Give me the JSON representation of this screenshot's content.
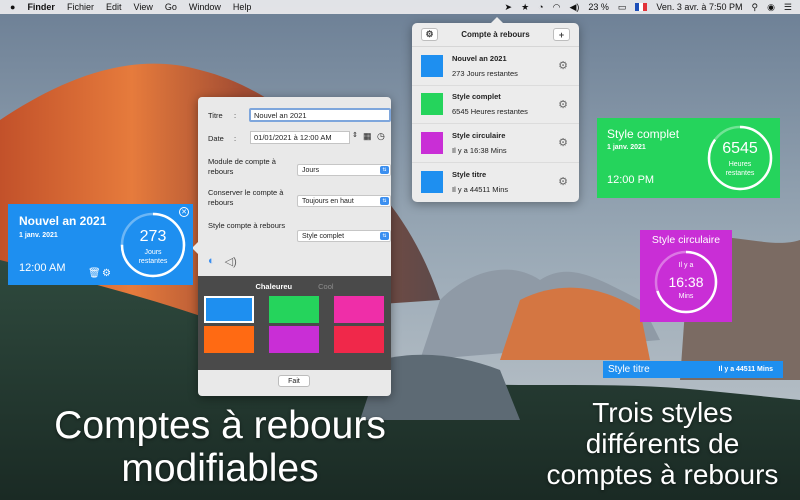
{
  "menubar": {
    "app": "Finder",
    "menus": [
      "Fichier",
      "Edit",
      "View",
      "Go",
      "Window",
      "Help"
    ],
    "battery": "23 %",
    "datetime": "Ven. 3 avr. à  7:50 PM"
  },
  "popover": {
    "title": "Compte à rebours",
    "items": [
      {
        "title": "Nouvel an 2021",
        "subtitle": "273 Jours restantes",
        "color": "#1e8ff0"
      },
      {
        "title": "Style complet",
        "subtitle": "6545 Heures restantes",
        "color": "#25d45c"
      },
      {
        "title": "Style circulaire",
        "subtitle": "Il y a 16:38 Mins",
        "color": "#c92ed6"
      },
      {
        "title": "Style titre",
        "subtitle": "Il y a 44511 Mins",
        "color": "#1e8ff0"
      }
    ]
  },
  "editor": {
    "title_label": "Titre",
    "title_value": "Nouvel an 2021",
    "date_label": "Date",
    "date_value": "01/01/2021 à 12:00 AM",
    "module_label": "Module de compte à rebours",
    "module_value": "Jours",
    "keep_label": "Conserver le compte à rebours",
    "keep_value": "Toujours en haut",
    "style_label": "Style compte à rebours",
    "style_value": "Style complet",
    "tab_warm": "Chaleureu",
    "tab_cool": "Cool",
    "swatches": [
      "#1e8ff0",
      "#25d45c",
      "#ef2ea8",
      "#ff6a13",
      "#c92ed6",
      "#f0284a"
    ],
    "done": "Fait"
  },
  "widget_blue": {
    "title": "Nouvel an 2021",
    "date": "1 janv. 2021",
    "time": "12:00 AM",
    "value": "273",
    "unit": "Jours restantes",
    "progress": 0.75
  },
  "widget_green": {
    "title": "Style complet",
    "date": "1 janv. 2021",
    "time": "12:00 PM",
    "value": "6545",
    "unit": "Heures restantes",
    "progress": 0.85
  },
  "widget_purple": {
    "title": "Style circulaire",
    "top": "Il y a",
    "value": "16:38",
    "unit": "Mins",
    "progress": 0.7
  },
  "widget_title": {
    "title": "Style titre",
    "value": "Il y a 44511 Mins"
  },
  "headline_left": "Comptes à rebours modifiables",
  "headline_right": "Trois styles différents de comptes à rebours"
}
